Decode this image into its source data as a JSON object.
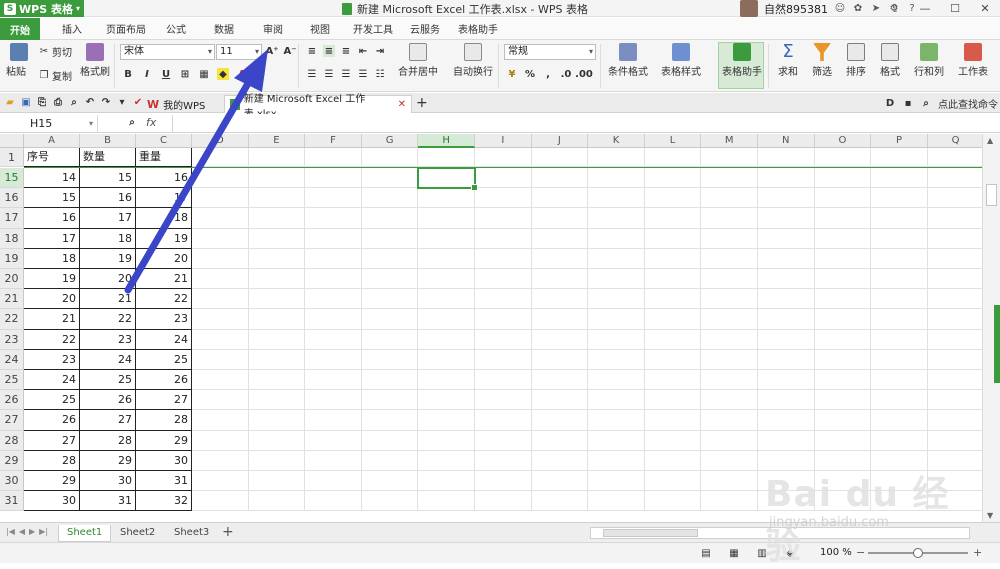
{
  "app": {
    "title": "WPS 表格",
    "doc_title": "新建 Microsoft Excel 工作表.xlsx - WPS 表格",
    "user": "自然895381"
  },
  "menu": [
    "开始",
    "插入",
    "页面布局",
    "公式",
    "数据",
    "审阅",
    "视图",
    "开发工具",
    "云服务",
    "表格助手"
  ],
  "ribbon": {
    "paste": "粘贴",
    "cut": "剪切",
    "copy": "复制",
    "format_painter": "格式刷",
    "font_name": "宋体",
    "font_size": "11",
    "merge_center": "合并居中",
    "wrap_text": "自动换行",
    "number_format": "常规",
    "percent": "%",
    "comma": ",",
    "conditional_format": "条件格式",
    "table_style": "表格样式",
    "table_helper": "表格助手",
    "sum": "求和",
    "filter": "筛选",
    "sort": "排序",
    "format": "格式",
    "row_col": "行和列",
    "worksheet": "工作表",
    "bold": "B",
    "italic": "I",
    "underline": "U"
  },
  "doc_tabs": {
    "home_tab": "我的WPS",
    "active_tab": "新建 Microsoft Excel 工作表.xlsx",
    "find_cmd": "点此查找命令"
  },
  "formula_bar": {
    "name_box": "H15",
    "fx": "fx",
    "value": ""
  },
  "grid": {
    "columns": [
      "A",
      "B",
      "C",
      "D",
      "E",
      "F",
      "G",
      "H",
      "I",
      "J",
      "K",
      "L",
      "M",
      "N",
      "O",
      "P",
      "Q"
    ],
    "selected_column": "H",
    "header_row": {
      "row": "1",
      "cells": [
        "序号",
        "数量",
        "重量"
      ]
    },
    "rows": [
      {
        "row": "15",
        "cells": [
          "14",
          "15",
          "16"
        ]
      },
      {
        "row": "16",
        "cells": [
          "15",
          "16",
          "17"
        ]
      },
      {
        "row": "17",
        "cells": [
          "16",
          "17",
          "18"
        ]
      },
      {
        "row": "18",
        "cells": [
          "17",
          "18",
          "19"
        ]
      },
      {
        "row": "19",
        "cells": [
          "18",
          "19",
          "20"
        ]
      },
      {
        "row": "20",
        "cells": [
          "19",
          "20",
          "21"
        ]
      },
      {
        "row": "21",
        "cells": [
          "20",
          "21",
          "22"
        ]
      },
      {
        "row": "22",
        "cells": [
          "21",
          "22",
          "23"
        ]
      },
      {
        "row": "23",
        "cells": [
          "22",
          "23",
          "24"
        ]
      },
      {
        "row": "24",
        "cells": [
          "23",
          "24",
          "25"
        ]
      },
      {
        "row": "25",
        "cells": [
          "24",
          "25",
          "26"
        ]
      },
      {
        "row": "26",
        "cells": [
          "25",
          "26",
          "27"
        ]
      },
      {
        "row": "27",
        "cells": [
          "26",
          "27",
          "28"
        ]
      },
      {
        "row": "28",
        "cells": [
          "27",
          "28",
          "29"
        ]
      },
      {
        "row": "29",
        "cells": [
          "28",
          "29",
          "30"
        ]
      },
      {
        "row": "30",
        "cells": [
          "29",
          "30",
          "31"
        ]
      },
      {
        "row": "31",
        "cells": [
          "30",
          "31",
          "32"
        ]
      }
    ],
    "selected_row": "15"
  },
  "sheets": [
    "Sheet1",
    "Sheet2",
    "Sheet3"
  ],
  "active_sheet": "Sheet1",
  "status": {
    "zoom": "100 %",
    "zoom_level": 0.5
  },
  "watermark": {
    "main": "Bai du 经验",
    "sub": "jingyan.baidu.com"
  },
  "colors": {
    "accent": "#3c9b3c",
    "arrow": "#3b45c8"
  }
}
